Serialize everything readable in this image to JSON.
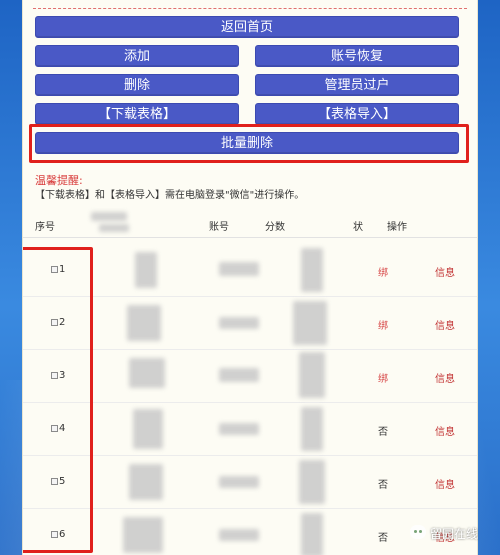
{
  "buttons": {
    "home": "返回首页",
    "add": "添加",
    "account_recover": "账号恢复",
    "delete": "删除",
    "admin_transfer": "管理员过户",
    "download_table": "【下载表格】",
    "import_table": "【表格导入】",
    "batch_delete": "批量删除"
  },
  "tip": {
    "title": "温馨提醒:",
    "text": "【下载表格】和【表格导入】需在电脑登录\"微信\"进行操作。"
  },
  "table": {
    "headers": {
      "seq": "序号",
      "account": "账号",
      "score": "分数",
      "status": "状",
      "action": "操作"
    },
    "rows": [
      {
        "seq": "1",
        "status": "绑",
        "status_color": "#d84a4a",
        "action": "信息"
      },
      {
        "seq": "2",
        "status": "绑",
        "status_color": "#d84a4a",
        "action": "信息"
      },
      {
        "seq": "3",
        "status": "绑",
        "status_color": "#d84a4a",
        "action": "信息"
      },
      {
        "seq": "4",
        "status": "否",
        "status_color": "#333333",
        "action": "信息"
      },
      {
        "seq": "5",
        "status": "否",
        "status_color": "#333333",
        "action": "信息"
      },
      {
        "seq": "6",
        "status": "否",
        "status_color": "#333333",
        "action": "信息"
      }
    ]
  },
  "watermark": {
    "text": "留园在线"
  },
  "colors": {
    "button_bg": "#4a59c6",
    "highlight": "#e0201c",
    "info_link": "#c23232"
  }
}
